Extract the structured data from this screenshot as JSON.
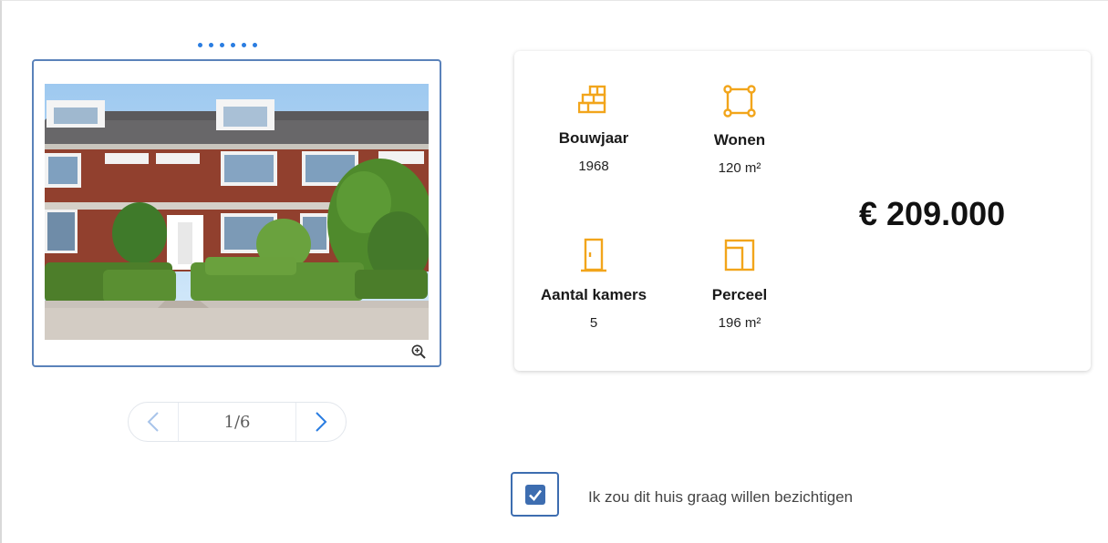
{
  "gallery": {
    "dots_count": 6,
    "counter": "1/6",
    "zoom_icon": "zoom-in-icon",
    "prev_icon": "chevron-left-icon",
    "next_icon": "chevron-right-icon"
  },
  "details": {
    "features": [
      {
        "label": "Bouwjaar",
        "value": "1968",
        "icon": "bricks-icon"
      },
      {
        "label": "Wonen",
        "value": "120 m²",
        "icon": "area-square-icon"
      },
      {
        "label": "Aantal kamers",
        "value": "5",
        "icon": "door-icon"
      },
      {
        "label": "Perceel",
        "value": "196 m²",
        "icon": "plot-icon"
      }
    ],
    "price": "€ 209.000"
  },
  "viewing": {
    "checked": true,
    "label": "Ik zou dit huis graag willen bezichtigen"
  },
  "colors": {
    "accent": "#2a7de1",
    "icon": "#f2a51b",
    "border": "#5a82ba"
  }
}
